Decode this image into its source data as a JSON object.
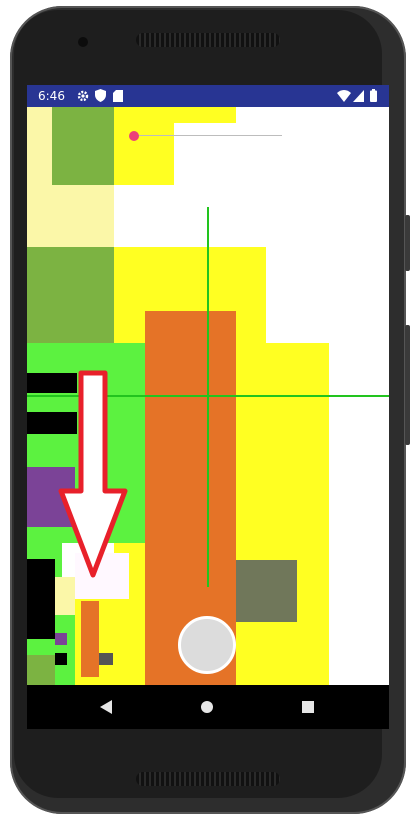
{
  "status_bar": {
    "time": "6:46",
    "left_icons": [
      "gear-icon",
      "shield-icon",
      "sim-card-icon"
    ],
    "right_icons": [
      "wifi-icon",
      "signal-icon",
      "battery-icon"
    ]
  },
  "nav_bar": {
    "icons": [
      "back-icon",
      "home-icon",
      "recents-icon"
    ]
  },
  "camera": {
    "shutter_icon": "shutter-button"
  },
  "overlay": {
    "arrow_color": "#e8202a",
    "accent_dot_color": "#ec407a",
    "crosshair_color": "#22c41e"
  }
}
